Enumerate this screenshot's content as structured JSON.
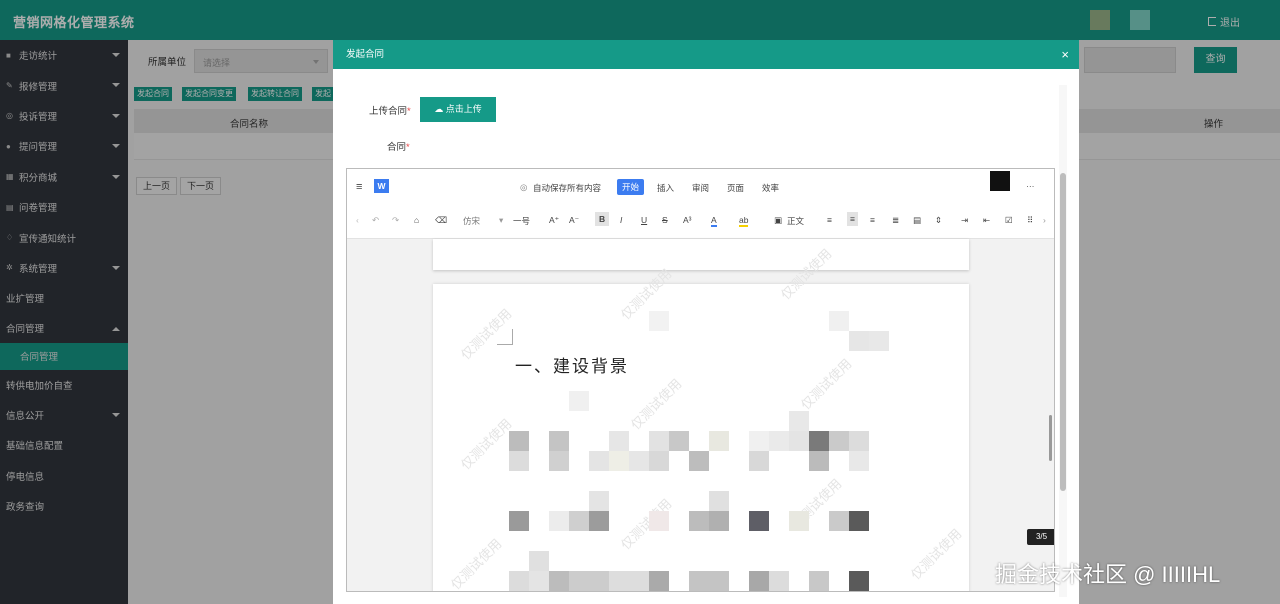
{
  "app": {
    "title": "营销网格化管理系统",
    "logout": "退出",
    "avatar_colors": [
      "#9ab48a",
      "#7fd4c8"
    ]
  },
  "sidebar": {
    "items": [
      {
        "label": "走访统计",
        "icon": "■",
        "arrow": "down"
      },
      {
        "label": "报修管理",
        "icon": "✎",
        "arrow": "down"
      },
      {
        "label": "投诉管理",
        "icon": "◎",
        "arrow": "down"
      },
      {
        "label": "提问管理",
        "icon": "●",
        "arrow": "down"
      },
      {
        "label": "积分商城",
        "icon": "▦",
        "arrow": "down"
      },
      {
        "label": "问卷管理",
        "icon": "▤",
        "arrow": ""
      },
      {
        "label": "宣传通知统计",
        "icon": "♢",
        "arrow": ""
      },
      {
        "label": "系统管理",
        "icon": "✲",
        "arrow": "down"
      },
      {
        "label": "业扩管理",
        "icon": "",
        "arrow": ""
      },
      {
        "label": "合同管理",
        "icon": "",
        "arrow": "up"
      },
      {
        "label": "合同管理",
        "icon": "",
        "arrow": "",
        "sub": true
      },
      {
        "label": "转供电加价自查",
        "icon": "",
        "arrow": ""
      },
      {
        "label": "信息公开",
        "icon": "",
        "arrow": "down"
      },
      {
        "label": "基础信息配置",
        "icon": "",
        "arrow": ""
      },
      {
        "label": "停电信息",
        "icon": "",
        "arrow": ""
      },
      {
        "label": "政务查询",
        "icon": "",
        "arrow": ""
      }
    ]
  },
  "main": {
    "filter_label": "所属单位",
    "filter_placeholder": "请选择",
    "query": "查询",
    "actions": [
      "发起合同",
      "发起合同变更",
      "发起转让合同",
      "发起"
    ],
    "columns": [
      "合同名称",
      "操作"
    ],
    "prev": "上一页",
    "next": "下一页"
  },
  "modal": {
    "title": "发起合同",
    "close": "×",
    "upload_label": "上传合同",
    "upload_button": "点击上传",
    "contract_label": "合同",
    "required_mark": "*"
  },
  "editor": {
    "autosave": "自动保存所有内容",
    "tabs": [
      "开始",
      "插入",
      "审阅",
      "页面",
      "效率"
    ],
    "font": "仿宋",
    "size": "一号",
    "style": "正文",
    "more": "···",
    "heading": "一、建设背景",
    "watermark": "仅测试使用",
    "page_indicator": "3/5"
  },
  "footer_watermark": "掘金技术社区 @ IIIIIHL"
}
